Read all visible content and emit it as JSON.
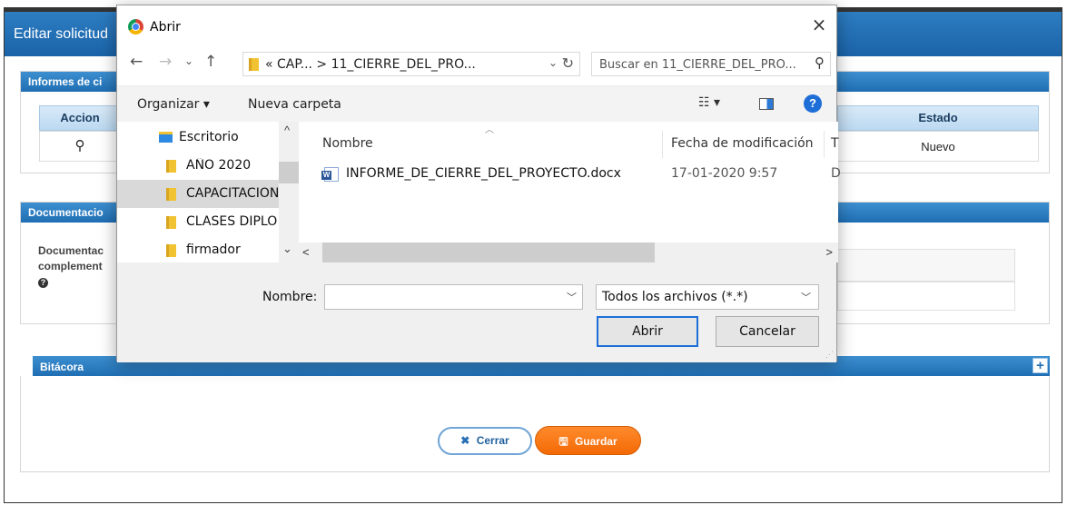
{
  "app": {
    "title": "Editar solicitud",
    "informes_panel": {
      "title": "Informes de ci",
      "col_acciones": "Accion",
      "col_estado": "Estado",
      "estado_value": "Nuevo",
      "search_icon": "search-icon"
    },
    "documentacion_panel": {
      "title": "Documentacio",
      "label_line1": "Documentac",
      "label_line2": "complement",
      "help_icon": "?"
    },
    "bitacora": {
      "title": "Bitácora",
      "add_icon": "+"
    },
    "buttons": {
      "cerrar": "Cerrar",
      "cerrar_icon": "✖",
      "guardar": "Guardar",
      "guardar_icon": "🖫"
    }
  },
  "dialog": {
    "title": "Abrir",
    "close_icon": "×",
    "nav": {
      "back_icon": "←",
      "forward_icon": "→",
      "recent_icon": "⌄",
      "up_icon": "↑",
      "address": "« CAP... > 11_CIERRE_DEL_PRO...",
      "address_dropdown": "⌄",
      "refresh_icon": "↻",
      "search_placeholder": "Buscar en 11_CIERRE_DEL_PRO...",
      "search_icon": "⚲"
    },
    "toolbar": {
      "organizar": "Organizar ▾",
      "nueva_carpeta": "Nueva carpeta",
      "view_icon": "☷ ▾",
      "help_icon": "?"
    },
    "folders": [
      {
        "label": "Escritorio",
        "icon": "desktop-folder-icon"
      },
      {
        "label": "AÑO 2020",
        "icon": "folder-icon"
      },
      {
        "label": "CAPACITACION",
        "icon": "folder-icon",
        "selected": true
      },
      {
        "label": "CLASES DIPLO",
        "icon": "folder-icon"
      },
      {
        "label": "firmador",
        "icon": "folder-icon"
      }
    ],
    "columns": {
      "nombre": "Nombre",
      "fecha": "Fecha de modificación",
      "tipo": "T"
    },
    "files": [
      {
        "name": "INFORME_DE_CIERRE_DEL_PROYECTO.docx",
        "date": "17-01-2020 9:57",
        "type": "D",
        "icon": "word-doc-icon"
      }
    ],
    "bottom": {
      "name_label": "Nombre:",
      "name_value": "",
      "filter": "Todos los archivos (*.*)",
      "open": "Abrir",
      "cancel": "Cancelar"
    }
  }
}
